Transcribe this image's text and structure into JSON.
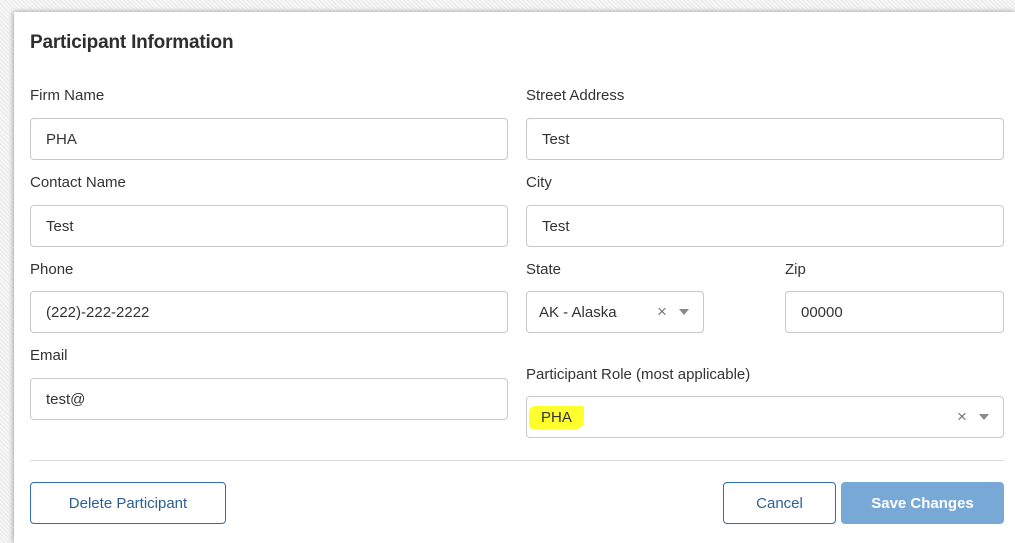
{
  "panel": {
    "title": "Participant Information"
  },
  "fields": {
    "firm_name": {
      "label": "Firm Name",
      "value": "PHA"
    },
    "contact_name": {
      "label": "Contact Name",
      "value": "Test"
    },
    "phone": {
      "label": "Phone",
      "value": "(222)-222-2222"
    },
    "email": {
      "label": "Email",
      "value": "test@"
    },
    "street_address": {
      "label": "Street Address",
      "value": "Test"
    },
    "city": {
      "label": "City",
      "value": "Test"
    },
    "state": {
      "label": "State",
      "value": "AK - Alaska"
    },
    "zip": {
      "label": "Zip",
      "value": "00000"
    },
    "participant_role": {
      "label": "Participant Role (most applicable)",
      "value": "PHA"
    }
  },
  "icons": {
    "clear": "×",
    "caret": "chevron-down-icon"
  },
  "buttons": {
    "delete": "Delete Participant",
    "cancel": "Cancel",
    "save": "Save Changes"
  },
  "colors": {
    "primary": "#78a9d6",
    "outline": "#2f6fab",
    "highlight": "#ffff2e"
  }
}
